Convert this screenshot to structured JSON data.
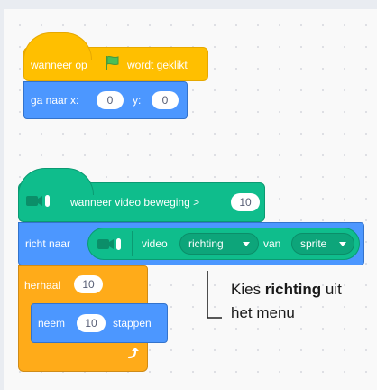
{
  "script1": {
    "hat_text_before": "wanneer op",
    "hat_text_after": "wordt geklikt",
    "goto_x_label": "ga naar x:",
    "x_value": "0",
    "goto_y_label": "y:",
    "y_value": "0"
  },
  "script2": {
    "hat_text": "wanneer video beweging >",
    "threshold": "10",
    "point_label": "richt naar",
    "video_label": "video",
    "attribute": "richting",
    "of_label": "van",
    "subject": "sprite",
    "repeat_label": "herhaal",
    "repeat_count": "10",
    "move_label": "neem",
    "steps": "10",
    "steps_label": "stappen"
  },
  "callout": {
    "prefix": "Kies ",
    "bold": "richting",
    "suffix": " uit",
    "line2": "het menu"
  },
  "colors": {
    "events": "#ffbf00",
    "motion": "#4c97ff",
    "control": "#ffab19",
    "video_sensing": "#0fbd8c"
  },
  "icons": [
    "green-flag-icon",
    "video-sensing-icon",
    "loop-arrow-icon"
  ]
}
